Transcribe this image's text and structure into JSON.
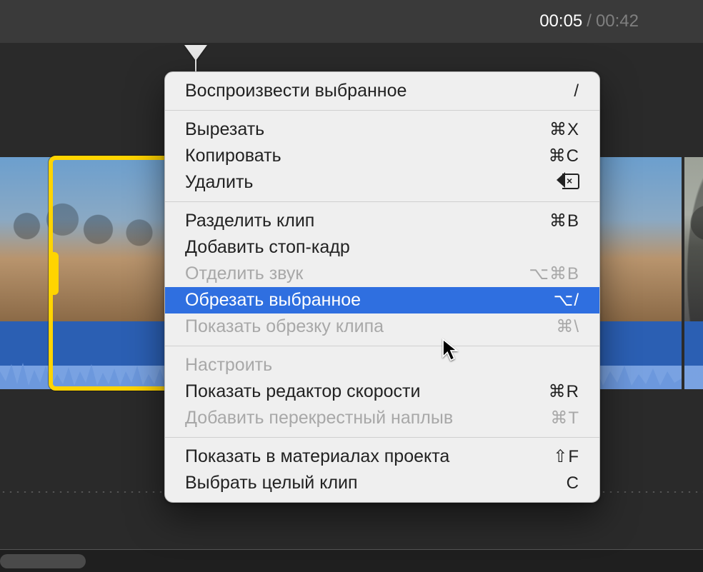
{
  "time": {
    "current": "00:05",
    "separator": "/",
    "total": "00:42"
  },
  "menu": {
    "groups": [
      [
        {
          "id": "play-selection",
          "label": "Воспроизвести выбранное",
          "shortcut": "/",
          "disabled": false,
          "highlight": false
        }
      ],
      [
        {
          "id": "cut",
          "label": "Вырезать",
          "shortcut": "⌘X",
          "disabled": false,
          "highlight": false
        },
        {
          "id": "copy",
          "label": "Копировать",
          "shortcut": "⌘C",
          "disabled": false,
          "highlight": false
        },
        {
          "id": "delete",
          "label": "Удалить",
          "shortcut": "⌫",
          "disabled": false,
          "highlight": false
        }
      ],
      [
        {
          "id": "split-clip",
          "label": "Разделить клип",
          "shortcut": "⌘B",
          "disabled": false,
          "highlight": false
        },
        {
          "id": "add-freeze-frame",
          "label": "Добавить стоп-кадр",
          "shortcut": "",
          "disabled": false,
          "highlight": false
        },
        {
          "id": "detach-audio",
          "label": "Отделить звук",
          "shortcut": "⌥⌘B",
          "disabled": true,
          "highlight": false
        },
        {
          "id": "trim-selection",
          "label": "Обрезать выбранное",
          "shortcut": "⌥/",
          "disabled": false,
          "highlight": true
        },
        {
          "id": "show-clip-trimmer",
          "label": "Показать обрезку клипа",
          "shortcut": "⌘\\",
          "disabled": true,
          "highlight": false
        }
      ],
      [
        {
          "id": "adjust",
          "label": "Настроить",
          "shortcut": "",
          "disabled": true,
          "highlight": false
        },
        {
          "id": "show-speed-editor",
          "label": "Показать редактор скорости",
          "shortcut": "⌘R",
          "disabled": false,
          "highlight": false
        },
        {
          "id": "add-cross-dissolve",
          "label": "Добавить перекрестный наплыв",
          "shortcut": "⌘T",
          "disabled": true,
          "highlight": false
        }
      ],
      [
        {
          "id": "reveal-in-project-media",
          "label": "Показать в материалах проекта",
          "shortcut": "⇧F",
          "disabled": false,
          "highlight": false
        },
        {
          "id": "select-entire-clip",
          "label": "Выбрать целый клип",
          "shortcut": "C",
          "disabled": false,
          "highlight": false
        }
      ]
    ]
  }
}
